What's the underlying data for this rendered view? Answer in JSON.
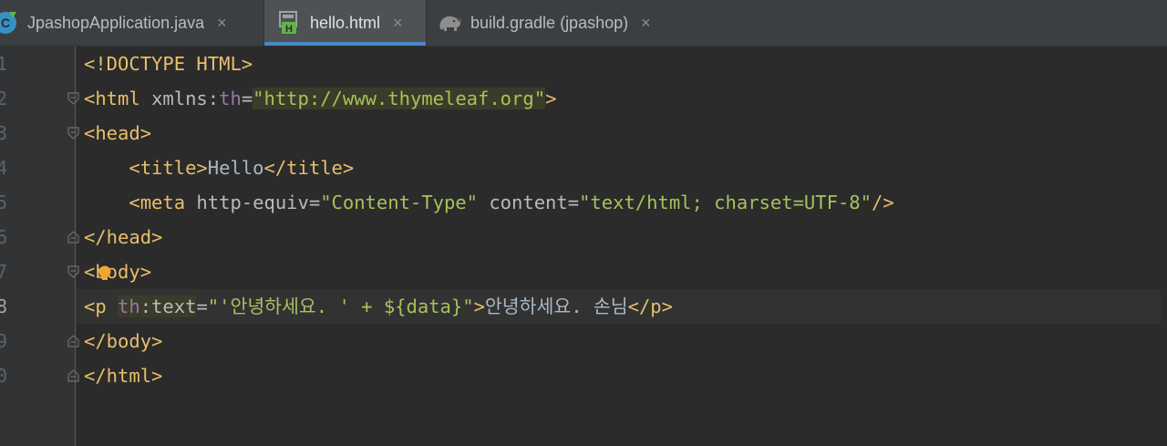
{
  "tabs": [
    {
      "label": "JpashopApplication.java",
      "icon": "java-class-icon",
      "active": false
    },
    {
      "label": "hello.html",
      "icon": "html-file-icon",
      "active": true
    },
    {
      "label": "build.gradle (jpashop)",
      "icon": "gradle-elephant-icon",
      "active": false
    }
  ],
  "close_glyph": "×",
  "editor": {
    "line_numbers": [
      "1",
      "2",
      "3",
      "4",
      "5",
      "6",
      "7",
      "8",
      "9",
      "0"
    ],
    "current_line": 8,
    "lines": {
      "l1": [
        "<!DOCTYPE HTML>"
      ],
      "l2": [
        "<html ",
        "xmlns:",
        "th",
        "=",
        "\"http://www.thymeleaf.org\"",
        ">"
      ],
      "l3": [
        "<head>"
      ],
      "l4": [
        "    <title>",
        "Hello",
        "</title>"
      ],
      "l5": [
        "    <meta ",
        "http-equiv",
        "=",
        "\"Content-Type\"",
        " content",
        "=",
        "\"text/html; charset=UTF-8\"",
        "/>"
      ],
      "l6": [
        "</head>"
      ],
      "l7": [
        "<",
        "body>"
      ],
      "l8": [
        "<p ",
        "th",
        ":text",
        "=",
        "\"'안녕하세요. ' + ${data}\"",
        ">",
        "안녕하세요. 손님",
        "</p>"
      ],
      "l9": [
        "</body>"
      ],
      "l10": [
        "</html>"
      ]
    }
  },
  "colors": {
    "tag": "#e8bf6a",
    "attr": "#bababa",
    "namespace": "#9876aa",
    "attr_value": "#a5c25c",
    "text": "#a9b7c6",
    "background": "#2b2b2b",
    "tab_underline": "#4a88c7"
  }
}
